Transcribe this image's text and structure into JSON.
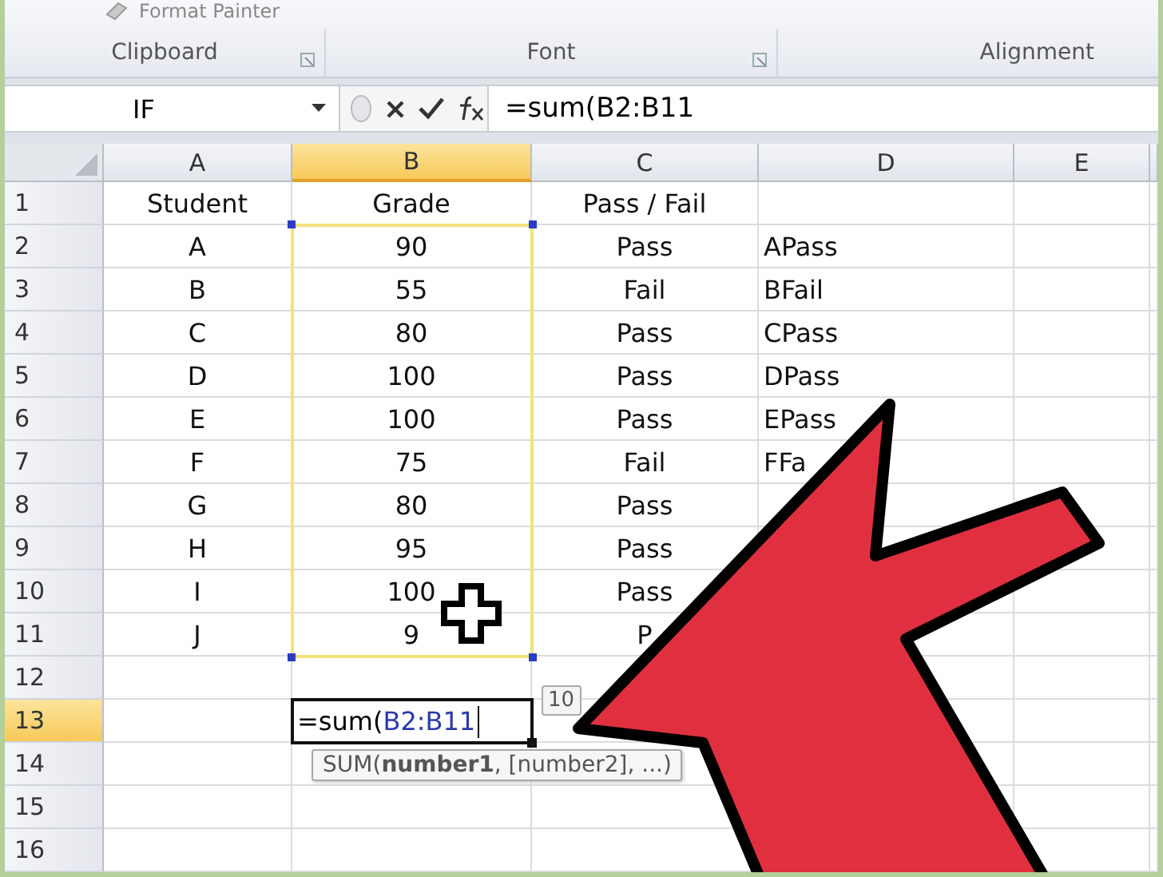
{
  "ribbon": {
    "format_painter": "Format Painter",
    "groups": [
      {
        "label": "Clipboard",
        "launcher": true
      },
      {
        "label": "Font",
        "launcher": true
      },
      {
        "label": "Alignment",
        "launcher": false
      }
    ]
  },
  "formula_bar": {
    "name_box": "IF",
    "formula": "=sum(B2:B11"
  },
  "columns": [
    {
      "label": "A",
      "selected": false
    },
    {
      "label": "B",
      "selected": true
    },
    {
      "label": "C",
      "selected": false
    },
    {
      "label": "D",
      "selected": false
    },
    {
      "label": "E",
      "selected": false
    }
  ],
  "rows": [
    {
      "number": "1",
      "selected": false,
      "cells": {
        "a": "Student",
        "b": "Grade",
        "c": "Pass / Fail"
      }
    },
    {
      "number": "2",
      "selected": false,
      "cells": {
        "a": "A",
        "b": "90",
        "c": "Pass",
        "d": "APass"
      }
    },
    {
      "number": "3",
      "selected": false,
      "cells": {
        "a": "B",
        "b": "55",
        "c": "Fail",
        "d": "BFail"
      }
    },
    {
      "number": "4",
      "selected": false,
      "cells": {
        "a": "C",
        "b": "80",
        "c": "Pass",
        "d": "CPass"
      }
    },
    {
      "number": "5",
      "selected": false,
      "cells": {
        "a": "D",
        "b": "100",
        "c": "Pass",
        "d": "DPass"
      }
    },
    {
      "number": "6",
      "selected": false,
      "cells": {
        "a": "E",
        "b": "100",
        "c": "Pass",
        "d": "EPass"
      }
    },
    {
      "number": "7",
      "selected": false,
      "cells": {
        "a": "F",
        "b": "75",
        "c": "Fail",
        "d": "FFa"
      }
    },
    {
      "number": "8",
      "selected": false,
      "cells": {
        "a": "G",
        "b": "80",
        "c": "Pass"
      }
    },
    {
      "number": "9",
      "selected": false,
      "cells": {
        "a": "H",
        "b": "95",
        "c": "Pass"
      }
    },
    {
      "number": "10",
      "selected": false,
      "cells": {
        "a": "I",
        "b": "100",
        "c": "Pass"
      }
    },
    {
      "number": "11",
      "selected": false,
      "cells": {
        "a": "J",
        "b": "9",
        "c": "P"
      }
    },
    {
      "number": "12",
      "selected": false,
      "cells": {}
    },
    {
      "number": "13",
      "selected": true,
      "cells": {}
    },
    {
      "number": "14",
      "selected": false,
      "cells": {}
    },
    {
      "number": "15",
      "selected": false,
      "cells": {}
    },
    {
      "number": "16",
      "selected": false,
      "cells": {}
    }
  ],
  "active_cell": {
    "prefix": "=sum(",
    "reference": "B2:B11"
  },
  "value_tooltip": "10",
  "function_tooltip": "SUM(**number1**, [number2], ...)"
}
